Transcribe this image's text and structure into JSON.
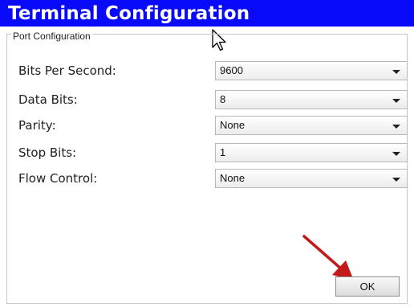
{
  "window": {
    "title": "Terminal Configuration"
  },
  "group": {
    "legend": "Port Configuration"
  },
  "fields": [
    {
      "label": "Bits Per Second:",
      "value": "9600"
    },
    {
      "label": "Data Bits:",
      "value": "8"
    },
    {
      "label": "Parity:",
      "value": "None"
    },
    {
      "label": "Stop Bits:",
      "value": "1"
    },
    {
      "label": "Flow Control:",
      "value": "None"
    }
  ],
  "buttons": {
    "ok_label": "OK"
  },
  "colors": {
    "titlebar": "#0a0afa",
    "annotation_arrow": "#c21a1a"
  }
}
